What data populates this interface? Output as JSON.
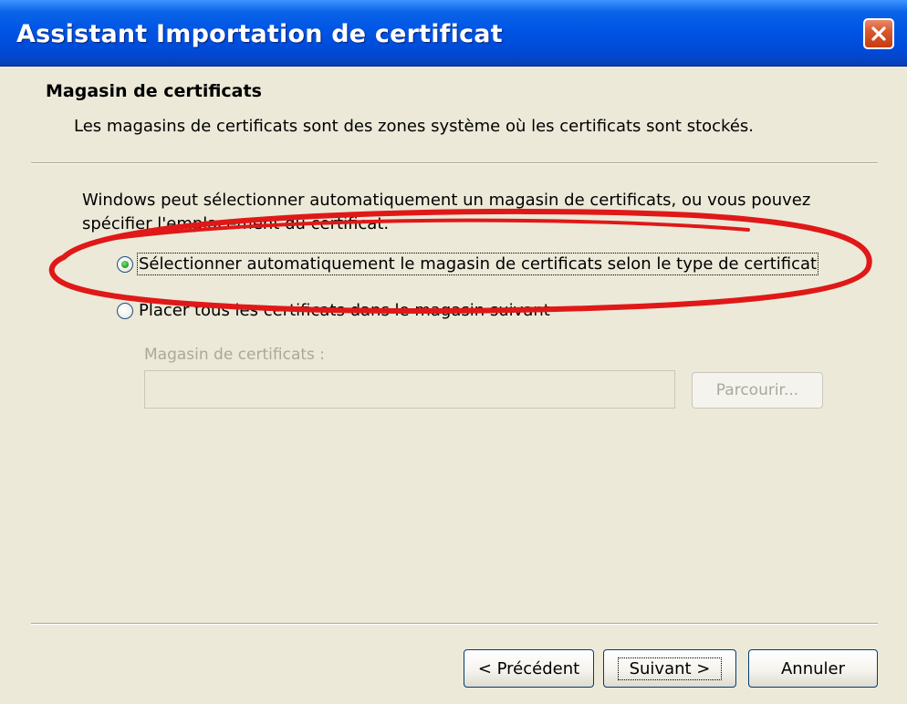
{
  "window": {
    "title": "Assistant Importation de certificat",
    "close_icon": "close-icon"
  },
  "header": {
    "title": "Magasin de certificats",
    "description": "Les magasins de certificats sont des zones système où les certificats sont stockés."
  },
  "body": {
    "intro": "Windows peut sélectionner automatiquement un magasin de certificats, ou vous pouvez spécifier l'emplacement du certificat.",
    "options": [
      {
        "label": "Sélectionner automatiquement le magasin de certificats selon le type de certificat",
        "selected": true
      },
      {
        "label": "Placer tous les certificats dans le magasin suivant",
        "selected": false
      }
    ],
    "store_field": {
      "label": "Magasin de certificats :",
      "value": "",
      "enabled": false
    },
    "browse_label": "Parcourir..."
  },
  "footer": {
    "prev_label": "< Précédent",
    "next_label": "Suivant >",
    "cancel_label": "Annuler"
  },
  "colors": {
    "titlebar": "#0055e5",
    "dialog_bg": "#ece9d8",
    "annotation": "#e01818",
    "radio_dot": "#21a121"
  }
}
